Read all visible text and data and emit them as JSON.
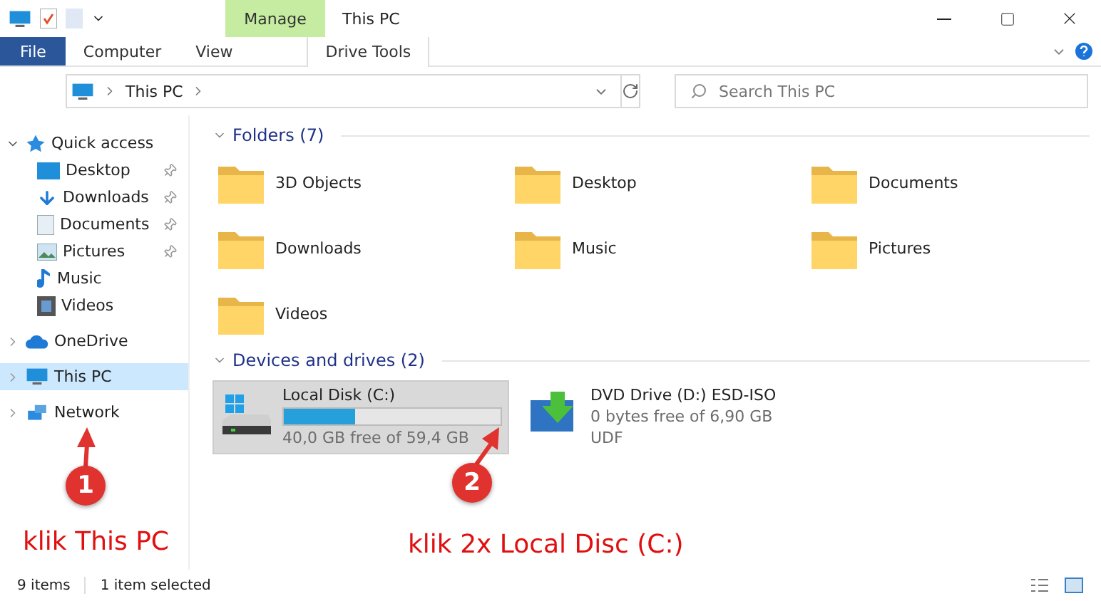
{
  "window": {
    "title": "This PC",
    "context_tab": "Manage"
  },
  "ribbon_tabs": [
    {
      "label": "File",
      "kind": "file",
      "selected": false
    },
    {
      "label": "Computer",
      "kind": "tab",
      "selected": false
    },
    {
      "label": "View",
      "kind": "tab",
      "selected": false
    },
    {
      "label": "Drive Tools",
      "kind": "context",
      "selected": false
    }
  ],
  "address_bar": {
    "path": "This PC"
  },
  "search": {
    "placeholder": "Search This PC"
  },
  "sidebar": {
    "items": [
      {
        "label": "Quick access",
        "expanded": true,
        "selected": false,
        "children": [
          {
            "label": "Desktop",
            "pinned": true
          },
          {
            "label": "Downloads",
            "pinned": true
          },
          {
            "label": "Documents",
            "pinned": true
          },
          {
            "label": "Pictures",
            "pinned": true
          },
          {
            "label": "Music",
            "pinned": false
          },
          {
            "label": "Videos",
            "pinned": false
          }
        ]
      },
      {
        "label": "OneDrive",
        "expanded": false,
        "selected": false
      },
      {
        "label": "This PC",
        "expanded": false,
        "selected": true
      },
      {
        "label": "Network",
        "expanded": false,
        "selected": false
      }
    ]
  },
  "folders": {
    "heading": "Folders (7)",
    "items": [
      "3D Objects",
      "Desktop",
      "Documents",
      "Downloads",
      "Music",
      "Pictures",
      "Videos"
    ]
  },
  "drives": {
    "heading": "Devices and drives (2)",
    "items": [
      {
        "kind": "disk",
        "name": "Local Disk (C:)",
        "selected": true,
        "level": 0.33,
        "info": "40,0 GB free of 59,4 GB"
      },
      {
        "kind": "dvd",
        "name": "DVD Drive (D:) ESD-ISO",
        "selected": false,
        "info": "0 bytes free of 6,90 GB",
        "format": "UDF"
      }
    ]
  },
  "annotations": [
    {
      "number": "1",
      "caption": "klik This PC"
    },
    {
      "number": "2",
      "caption": "klik 2x Local Disc (C:)"
    }
  ],
  "status_bar": {
    "count": "9 items",
    "selection": "1 item selected"
  }
}
